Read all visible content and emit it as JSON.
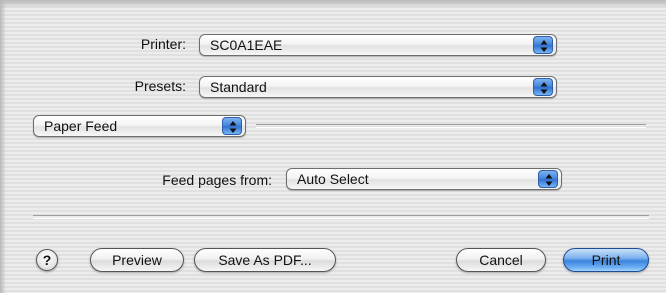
{
  "printer": {
    "label": "Printer:",
    "value": "SC0A1EAE"
  },
  "presets": {
    "label": "Presets:",
    "value": "Standard"
  },
  "panel": {
    "value": "Paper Feed"
  },
  "feed": {
    "label": "Feed pages from:",
    "value": "Auto Select"
  },
  "buttons": {
    "help": "?",
    "preview": "Preview",
    "save_pdf": "Save As PDF...",
    "cancel": "Cancel",
    "print": "Print"
  },
  "colors": {
    "accent": "#3c84de",
    "popup_arrow": "#3f82da"
  },
  "icons": {
    "popup_arrows": "up-down-arrows-icon",
    "help": "question-mark-icon"
  }
}
